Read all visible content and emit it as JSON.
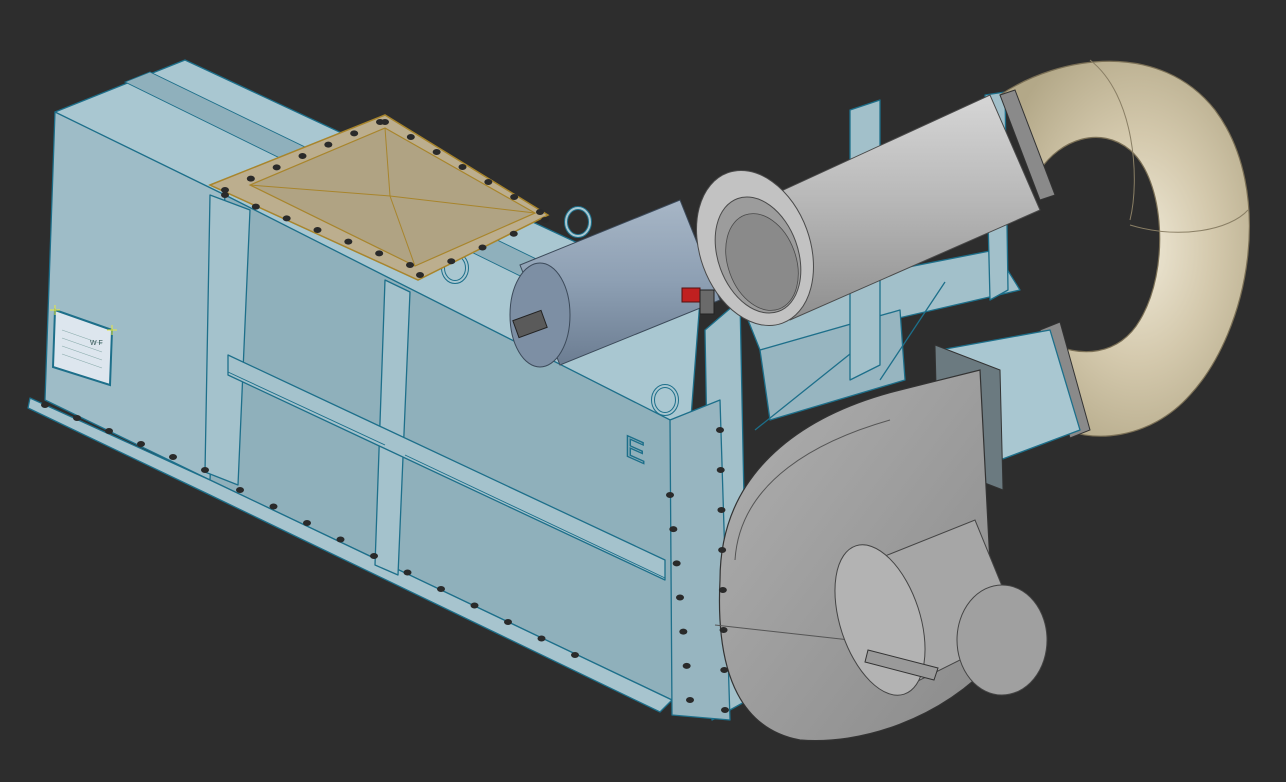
{
  "viewport": {
    "background_color": "#2d2d2d"
  },
  "model": {
    "colors": {
      "housing_face": "#97b5c0",
      "housing_top": "#a9c7d1",
      "housing_edge": "#1d6f8a",
      "hatch_cover": "#bcae8e",
      "hatch_edge": "#a8852c",
      "cylinder": "#8d9fb3",
      "duct_grey": "#b7b7b7",
      "elbow_tan": "#d4c9ad",
      "bolt": "#2a2a2a"
    },
    "nameplate": {
      "text": "W F"
    },
    "side_mark": {
      "text": "E"
    }
  }
}
